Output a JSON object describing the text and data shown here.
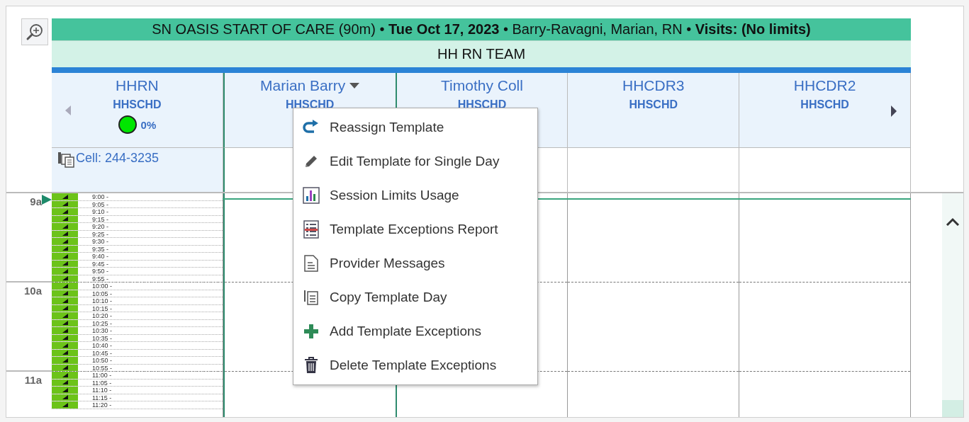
{
  "header": {
    "title": "SN OASIS START OF CARE (90m) • **Tue Oct 17, 2023** • Barry-Ravagni, Marian, RN • **Visits: (No limits)**",
    "team": "HH RN TEAM"
  },
  "columns": [
    {
      "name": "HHRN",
      "sub": "HHSCHD",
      "selected": false,
      "dropdown": false,
      "status": {
        "percent": "0%",
        "color": "#00e600"
      },
      "phone": "Cell: 244-3235"
    },
    {
      "name": "Marian Barry",
      "sub": "HHSCHD",
      "selected": true,
      "dropdown": true
    },
    {
      "name": "Timothy Coll",
      "sub": "HHSCHD",
      "selected": false,
      "dropdown": false
    },
    {
      "name": "HHCDR3",
      "sub": "HHSCHD",
      "selected": false,
      "dropdown": false
    },
    {
      "name": "HHCDR2",
      "sub": "HHSCHD",
      "selected": false,
      "dropdown": false
    }
  ],
  "hours": [
    {
      "label": "9a",
      "slots": [
        "9:00 -",
        "9:05 -",
        "9:10 -",
        "9:15 -",
        "9:20 -",
        "9:25 -",
        "9:30 -",
        "9:35 -",
        "9:40 -",
        "9:45 -",
        "9:50 -",
        "9:55 -"
      ]
    },
    {
      "label": "10a",
      "slots": [
        "10:00 -",
        "10:05 -",
        "10:10 -",
        "10:15 -",
        "10:20 -",
        "10:25 -",
        "10:30 -",
        "10:35 -",
        "10:40 -",
        "10:45 -",
        "10:50 -",
        "10:55 -"
      ]
    },
    {
      "label": "11a",
      "slots": [
        "11:00 -",
        "11:05 -",
        "11:10 -",
        "11:15 -",
        "11:20 -"
      ]
    }
  ],
  "context_menu": [
    {
      "kind": "reassign",
      "label": "Reassign Template"
    },
    {
      "kind": "edit",
      "label": "Edit Template for Single Day"
    },
    {
      "kind": "chart",
      "label": "Session Limits Usage"
    },
    {
      "kind": "report",
      "label": "Template Exceptions Report"
    },
    {
      "kind": "document",
      "label": "Provider Messages"
    },
    {
      "kind": "copy",
      "label": "Copy Template Day"
    },
    {
      "kind": "add",
      "label": "Add Template Exceptions"
    },
    {
      "kind": "delete",
      "label": "Delete Template Exceptions"
    }
  ]
}
